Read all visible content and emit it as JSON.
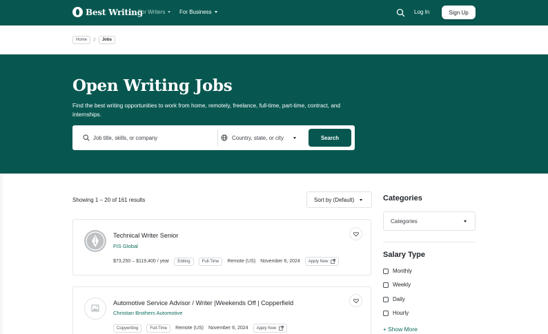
{
  "brand": {
    "name": "Best Writing",
    "primary_color": "#075750",
    "accent_text_color": "#0b6b5e"
  },
  "nav": {
    "items": [
      {
        "label": "For Writers",
        "dropdown": true
      },
      {
        "label": "For Business",
        "dropdown": true
      }
    ],
    "search_icon": "search-icon",
    "login": "Log In",
    "signup": "Sign Up"
  },
  "breadcrumb": [
    "Home",
    "/",
    "Jobs"
  ],
  "hero": {
    "title": "Open Writing Jobs",
    "description": "Find the best writing opportunities to work from home, remotely, freelance, full-time, part-time, contract, and internships.",
    "search": {
      "keyword_placeholder": "Job title, skills, or company",
      "location_placeholder": "Country, state, or city",
      "button": "Search"
    }
  },
  "results": {
    "summary": "Showing 1 – 20 of 161 results",
    "sort_label": "Sort by (Default)"
  },
  "jobs": [
    {
      "title": "Technical Writer Senior",
      "company": "FIS Global",
      "salary": "$73,250 – $119,400 / year",
      "category": "Editing",
      "type": "Full-Time",
      "location": "Remote (US)",
      "date": "November 6, 2024",
      "apply": "Apply Now"
    },
    {
      "title": "Automotive Service Advisor / Writer |Weekends Off | Copperfield",
      "company": "Christian Brothers Automotive",
      "category": "Copywriting",
      "type": "Full-Time",
      "location": "Remote (US)",
      "date": "November 6, 2024",
      "apply": "Apply Now"
    }
  ],
  "sidebar": {
    "categories_heading": "Categories",
    "categories_select": "Categories",
    "salary_heading": "Salary Type",
    "salary_options": [
      "Monthly",
      "Weekly",
      "Daily",
      "Hourly"
    ],
    "show_more": "Show More"
  }
}
